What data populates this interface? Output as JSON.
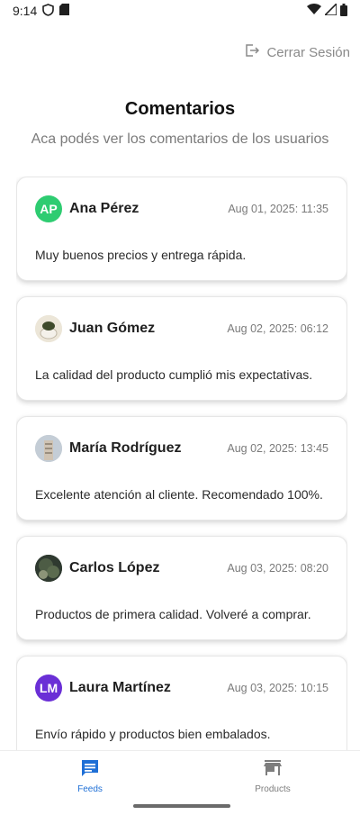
{
  "status_bar": {
    "time": "9:14"
  },
  "header": {
    "logout_label": "Cerrar Sesión"
  },
  "page": {
    "title": "Comentarios",
    "subtitle": "Aca podés ver los comentarios de los usuarios"
  },
  "comments": [
    {
      "initials": "AP",
      "avatar_color": "#2ecc71",
      "author": "Ana Pérez",
      "date": "Aug 01, 2025: 11:35",
      "text": "Muy buenos precios y entrega rápida."
    },
    {
      "initials": "",
      "avatar_color": "#d9d2c2",
      "author": "Juan Gómez",
      "date": "Aug 02, 2025: 06:12",
      "text": "La calidad del producto cumplió mis expectativas."
    },
    {
      "initials": "",
      "avatar_color": "#b7c3cf",
      "author": "María Rodríguez",
      "date": "Aug 02, 2025: 13:45",
      "text": "Excelente atención al cliente. Recomendado 100%."
    },
    {
      "initials": "",
      "avatar_color": "#3c4a3a",
      "author": "Carlos López",
      "date": "Aug 03, 2025: 08:20",
      "text": "Productos de primera calidad. Volveré a comprar."
    },
    {
      "initials": "LM",
      "avatar_color": "#6a2fd6",
      "author": "Laura Martínez",
      "date": "Aug 03, 2025: 10:15",
      "text": "Envío rápido y productos bien embalados."
    }
  ],
  "bottom_nav": {
    "feeds_label": "Feeds",
    "products_label": "Products",
    "active_color": "#1e6fd6"
  }
}
